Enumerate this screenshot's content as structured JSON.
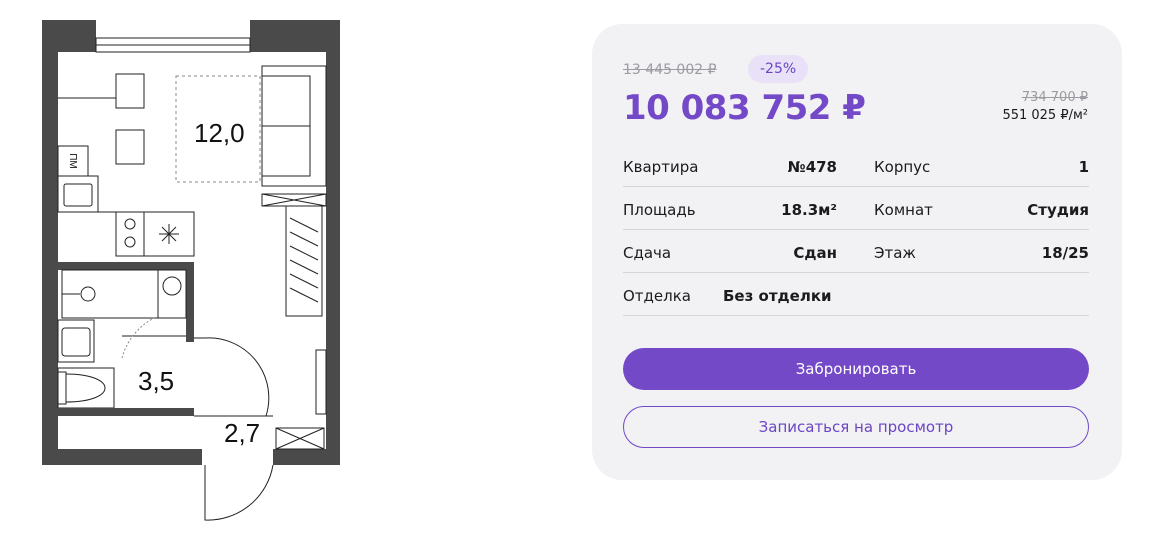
{
  "plan": {
    "rooms": [
      {
        "id": "living",
        "area": "12,0"
      },
      {
        "id": "bath",
        "area": "3,5"
      },
      {
        "id": "hall",
        "area": "2,7"
      }
    ],
    "fridge_label": "ПМ"
  },
  "offer": {
    "old_price": "13 445 002 ₽",
    "discount": "-25%",
    "price": "10 083 752 ₽",
    "old_price_per_sqm": "734 700 ₽",
    "price_per_sqm": "551 025 ₽/м²"
  },
  "details": [
    {
      "left_label": "Квартира",
      "left_value": "№478",
      "right_label": "Корпус",
      "right_value": "1"
    },
    {
      "left_label": "Площадь",
      "left_value": "18.3м²",
      "right_label": "Комнат",
      "right_value": "Студия"
    },
    {
      "left_label": "Сдача",
      "left_value": "Сдан",
      "right_label": "Этаж",
      "right_value": "18/25"
    },
    {
      "left_label": "Отделка",
      "left_value": "Без отделки"
    }
  ],
  "actions": {
    "book": "Забронировать",
    "viewing": "Записаться на просмотр"
  },
  "colors": {
    "accent": "#7349c7",
    "card_bg": "#f2f2f4",
    "discount_bg": "#e8e1f7",
    "wall": "#4a4a4a"
  }
}
